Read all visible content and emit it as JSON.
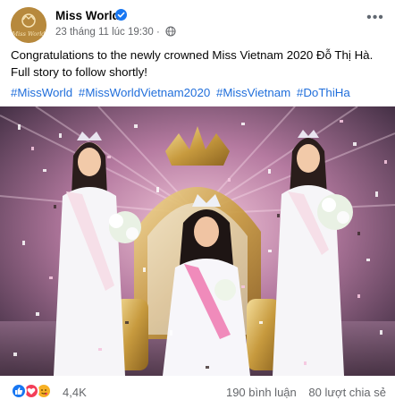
{
  "post": {
    "page_name": "Miss World",
    "avatar_text": "Miss World",
    "timestamp": "23 tháng 11 lúc 19:30",
    "privacy": "globe-icon",
    "more_label": "•••",
    "caption_line1": "Congratulations to the newly crowned Miss Vietnam 2020 Đỗ Thị Hà.",
    "caption_line2": "Full story to follow shortly!",
    "hashtags": [
      "#MissWorld",
      "#MissWorldVietnam2020",
      "#MissVietnam",
      "#DoThiHa"
    ],
    "photo_alt": "Miss Vietnam 2020 coronation",
    "reactions": {
      "icons": [
        "like-icon",
        "love-icon",
        "care-icon"
      ],
      "count": "4,4K"
    },
    "comments": "190 bình luận",
    "shares": "80 lượt chia sẻ"
  },
  "colors": {
    "link": "#216fdb",
    "meta": "#65676b",
    "verified": "#1877f2",
    "brand_gold": "#b7893d"
  }
}
